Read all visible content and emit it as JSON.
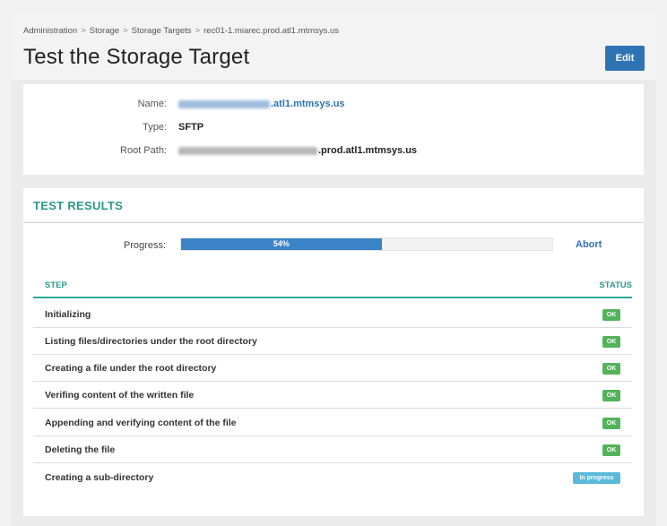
{
  "breadcrumb": {
    "items": [
      "Administration",
      "Storage",
      "Storage Targets",
      "rec01-1.miarec.prod.atl1.mtmsys.us"
    ],
    "separator": ">"
  },
  "page_title": "Test the Storage Target",
  "edit_button": "Edit",
  "info": {
    "name_label": "Name:",
    "name_value": ".atl1.mtmsys.us",
    "type_label": "Type:",
    "type_value": "SFTP",
    "root_label": "Root Path:",
    "root_value": ".prod.atl1.mtmsys.us"
  },
  "results": {
    "title": "TEST RESULTS",
    "progress_label": "Progress:",
    "progress_value": 54,
    "progress_text": "54%",
    "abort_label": "Abort",
    "col_step": "STEP",
    "col_status": "STATUS",
    "steps": [
      {
        "name": "Initializing",
        "status": "OK"
      },
      {
        "name": "Listing files/directories under the root directory",
        "status": "OK"
      },
      {
        "name": "Creating a file under the root directory",
        "status": "OK"
      },
      {
        "name": "Verifing content of the written file",
        "status": "OK"
      },
      {
        "name": "Appending and verifying content of the file",
        "status": "OK"
      },
      {
        "name": "Deleting the file",
        "status": "OK"
      },
      {
        "name": "Creating a sub-directory",
        "status": "In progress"
      }
    ]
  },
  "colors": {
    "accent": "#2e74b5",
    "teal": "#29998b",
    "ok_green": "#53b35a",
    "progress_blue": "#5bb9d9"
  }
}
